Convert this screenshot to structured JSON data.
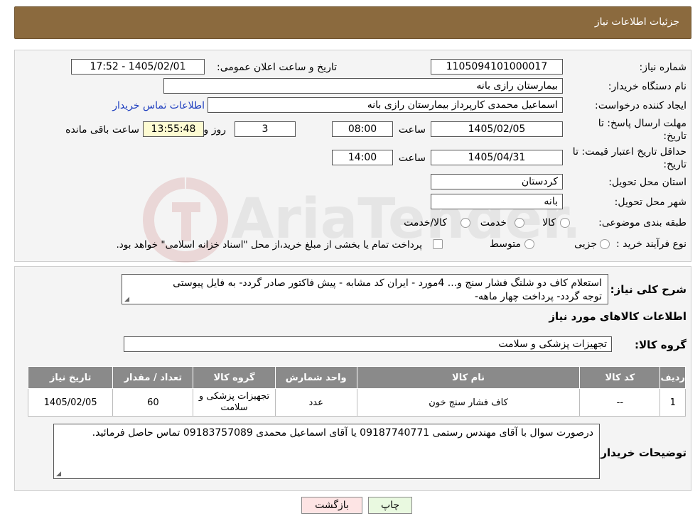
{
  "header": {
    "title": "جزئیات اطلاعات نیاز"
  },
  "need_number": {
    "label": "شماره نیاز:",
    "value": "1105094101000017"
  },
  "announce": {
    "label": "تاریخ و ساعت اعلان عمومی:",
    "value": "1405/02/01 - 17:52"
  },
  "buyer_org": {
    "label": "نام دستگاه خریدار:",
    "value": "بیمارستان رازی بانه"
  },
  "requester": {
    "label": "ایجاد کننده درخواست:",
    "value": "اسماعیل محمدی کارپرداز بیمارستان رازی بانه",
    "contact_link": "اطلاعات تماس خریدار"
  },
  "deadline": {
    "label_line1": "مهلت ارسال پاسخ: تا",
    "label_line2": "تاریخ:",
    "date": "1405/02/05",
    "time_label": "ساعت",
    "time": "08:00",
    "days": "3",
    "days_label": "روز و",
    "remaining": "13:55:48",
    "remaining_label": "ساعت باقی مانده"
  },
  "validity": {
    "label_line1": "حداقل تاریخ اعتبار قیمت: تا",
    "label_line2": "تاریخ:",
    "date": "1405/04/31",
    "time_label": "ساعت",
    "time": "14:00"
  },
  "province": {
    "label": "استان محل تحویل:",
    "value": "کردستان"
  },
  "city": {
    "label": "شهر محل تحویل:",
    "value": "بانه"
  },
  "category": {
    "label": "طبقه بندی موضوعی:",
    "options": [
      "کالا",
      "خدمت",
      "کالا/خدمت"
    ]
  },
  "process": {
    "label": "نوع فرآیند خرید :",
    "options": [
      "جزیی",
      "متوسط"
    ],
    "note": "پرداخت تمام یا بخشی از مبلغ خرید،از محل \"اسناد خزانه اسلامی\" خواهد بود."
  },
  "description": {
    "label": "شرح کلی نیاز:",
    "line1": "استعلام  کاف دو شلنگ فشار سنج و... 4مورد - ایران کد مشابه - پیش فاکتور صادر گردد- به فایل پیوستی",
    "line2": "توجه گردد- پرداخت چهار ماهه-"
  },
  "goods_section_title": "اطلاعات کالاهای مورد نیاز",
  "goods_group": {
    "label": "گروه کالا:",
    "value": "تجهیزات پزشکی و سلامت"
  },
  "table": {
    "headers": [
      "ردیف",
      "کد کالا",
      "نام کالا",
      "واحد شمارش",
      "گروه کالا",
      "تعداد / مقدار",
      "تاریخ نیاز"
    ],
    "rows": [
      {
        "row": "1",
        "code": "--",
        "name": "کاف فشار سنج خون",
        "unit": "عدد",
        "group_line1": "تجهیزات پزشکی و",
        "group_line2": "سلامت",
        "qty": "60",
        "date": "1405/02/05"
      }
    ]
  },
  "buyer_notes": {
    "label": "توضیحات خریدار:",
    "text": "درصورت سوال با آقای مهندس رستمی 09187740771 یا آقای اسماعیل محمدی 09183757089 تماس حاصل فرمائید."
  },
  "buttons": {
    "print": "چاپ",
    "back": "بازگشت"
  },
  "watermark_text": "AriaTender.neT",
  "colors": {
    "header_bg": "#8b6a3e",
    "link": "#1f3fbf",
    "print_btn": "#e9f9e0",
    "back_btn": "#fde4e4",
    "remaining_bg": "#fdfbd2"
  }
}
